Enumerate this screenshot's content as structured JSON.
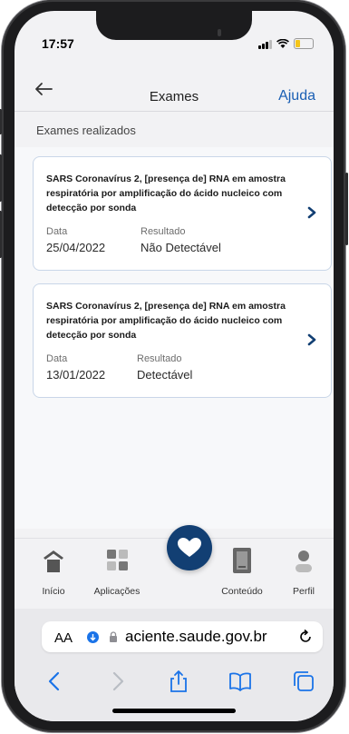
{
  "status": {
    "time": "17:57"
  },
  "header": {
    "title": "Exames",
    "help": "Ajuda"
  },
  "section": {
    "label": "Exames realizados"
  },
  "exams": [
    {
      "title": "SARS Coronavírus 2, [presença de] RNA em amostra respiratória por amplificação do ácido nucleico com detecção por sonda",
      "date_label": "Data",
      "date": "25/04/2022",
      "result_label": "Resultado",
      "result": "Não Detectável"
    },
    {
      "title": "SARS Coronavírus 2, [presença de] RNA em amostra respiratória por amplificação do ácido nucleico com detecção por sonda",
      "date_label": "Data",
      "date": "13/01/2022",
      "result_label": "Resultado",
      "result": "Detectável"
    }
  ],
  "nav": {
    "items": [
      {
        "label": "Início",
        "icon": "home-icon"
      },
      {
        "label": "Aplicações",
        "icon": "apps-grid-icon"
      },
      {
        "label": "Conteúdo",
        "icon": "book-icon"
      },
      {
        "label": "Perfil",
        "icon": "user-icon"
      }
    ],
    "fab_icon": "heart-icon"
  },
  "browser": {
    "aa": "AA",
    "url": "aciente.saude.gov.br"
  },
  "colors": {
    "accent": "#1a5fb4",
    "fab": "#123f73",
    "card_border": "#c9d6e8"
  }
}
